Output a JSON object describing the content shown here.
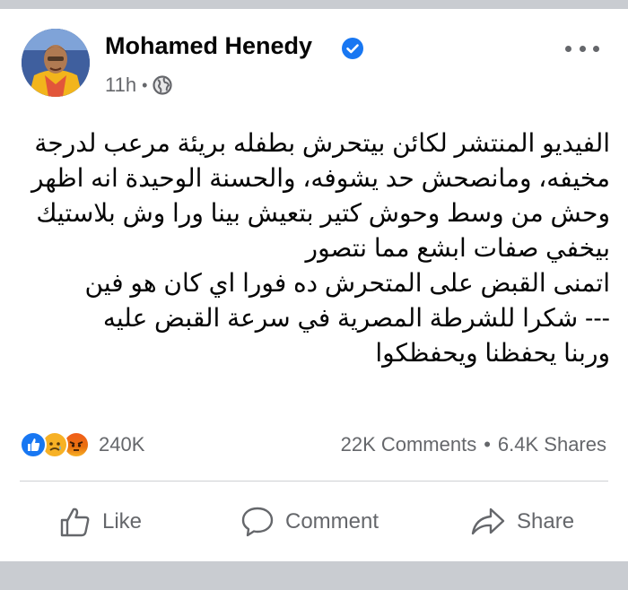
{
  "post": {
    "author": "Mohamed Henedy",
    "time": "11h",
    "separator": "•",
    "body_lines": [
      "الفيديو المنتشر لكائن بيتحرش بطفله بريئة مرعب لدرجة",
      "مخيفه، ومانصحش حد يشوفه، والحسنة الوحيدة انه اظهر",
      "وحش من وسط وحوش كتير بتعيش بينا ورا وش بلاستيك",
      "بيخفي صفات ابشع مما نتصور",
      "اتمنى القبض على المتحرش ده فورا اي كان هو فين",
      "--- شكرا للشرطة المصرية في سرعة القبض عليه",
      "وربنا يحفظنا ويحفظكوا"
    ]
  },
  "stats": {
    "reaction_icons": [
      "like-reaction-icon",
      "sad-reaction-icon",
      "angry-reaction-icon"
    ],
    "reactions_count": "240K",
    "comments": "22K Comments",
    "dot": "•",
    "shares": "6.4K Shares"
  },
  "actions": {
    "like_label": "Like",
    "comment_label": "Comment",
    "share_label": "Share"
  },
  "colors": {
    "accent": "#1877f2",
    "secondary_text": "#65676b",
    "divider": "#ced0d4",
    "background_band": "#c9ccd1"
  }
}
